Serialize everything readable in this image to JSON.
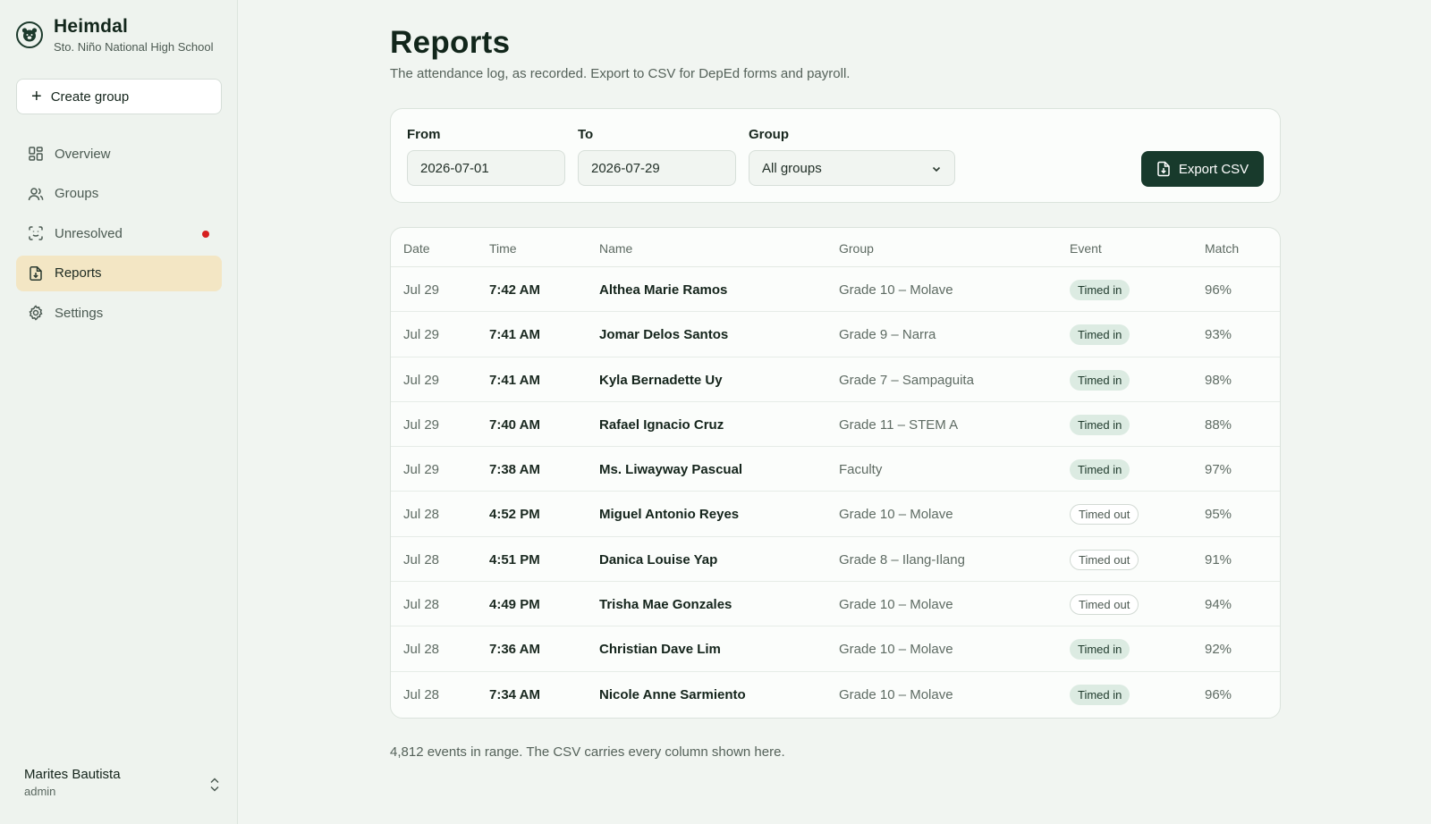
{
  "brand": {
    "name": "Heimdal",
    "school": "Sto. Niño National High School"
  },
  "sidebar": {
    "create_label": "Create group",
    "items": [
      {
        "label": "Overview",
        "icon": "grid-icon"
      },
      {
        "label": "Groups",
        "icon": "users-icon"
      },
      {
        "label": "Unresolved",
        "icon": "face-scan-icon",
        "alert": true
      },
      {
        "label": "Reports",
        "icon": "file-download-icon",
        "active": true
      },
      {
        "label": "Settings",
        "icon": "gear-icon"
      }
    ]
  },
  "user": {
    "name": "Marites Bautista",
    "role": "admin"
  },
  "page": {
    "title": "Reports",
    "subtitle": "The attendance log, as recorded. Export to CSV for DepEd forms and payroll."
  },
  "filters": {
    "from_label": "From",
    "from_value": "2026-07-01",
    "to_label": "To",
    "to_value": "2026-07-29",
    "group_label": "Group",
    "group_value": "All groups",
    "export_label": "Export CSV"
  },
  "table": {
    "headers": [
      "Date",
      "Time",
      "Name",
      "Group",
      "Event",
      "Match"
    ],
    "rows": [
      {
        "date": "Jul 29",
        "time": "7:42 AM",
        "name": "Althea Marie Ramos",
        "group": "Grade 10 – Molave",
        "event": "Timed in",
        "match": "96%"
      },
      {
        "date": "Jul 29",
        "time": "7:41 AM",
        "name": "Jomar Delos Santos",
        "group": "Grade 9 – Narra",
        "event": "Timed in",
        "match": "93%"
      },
      {
        "date": "Jul 29",
        "time": "7:41 AM",
        "name": "Kyla Bernadette Uy",
        "group": "Grade 7 – Sampaguita",
        "event": "Timed in",
        "match": "98%"
      },
      {
        "date": "Jul 29",
        "time": "7:40 AM",
        "name": "Rafael Ignacio Cruz",
        "group": "Grade 11 – STEM A",
        "event": "Timed in",
        "match": "88%"
      },
      {
        "date": "Jul 29",
        "time": "7:38 AM",
        "name": "Ms. Liwayway Pascual",
        "group": "Faculty",
        "event": "Timed in",
        "match": "97%"
      },
      {
        "date": "Jul 28",
        "time": "4:52 PM",
        "name": "Miguel Antonio Reyes",
        "group": "Grade 10 – Molave",
        "event": "Timed out",
        "match": "95%"
      },
      {
        "date": "Jul 28",
        "time": "4:51 PM",
        "name": "Danica Louise Yap",
        "group": "Grade 8 – Ilang-Ilang",
        "event": "Timed out",
        "match": "91%"
      },
      {
        "date": "Jul 28",
        "time": "4:49 PM",
        "name": "Trisha Mae Gonzales",
        "group": "Grade 10 – Molave",
        "event": "Timed out",
        "match": "94%"
      },
      {
        "date": "Jul 28",
        "time": "7:36 AM",
        "name": "Christian Dave Lim",
        "group": "Grade 10 – Molave",
        "event": "Timed in",
        "match": "92%"
      },
      {
        "date": "Jul 28",
        "time": "7:34 AM",
        "name": "Nicole Anne Sarmiento",
        "group": "Grade 10 – Molave",
        "event": "Timed in",
        "match": "96%"
      }
    ]
  },
  "footnote": "4,812 events in range. The CSV carries every column shown here.",
  "colors": {
    "accent": "#183a2c",
    "active_nav": "#f3e6c4",
    "alert": "#d61f1f",
    "badge_in": "#dcebe2"
  }
}
